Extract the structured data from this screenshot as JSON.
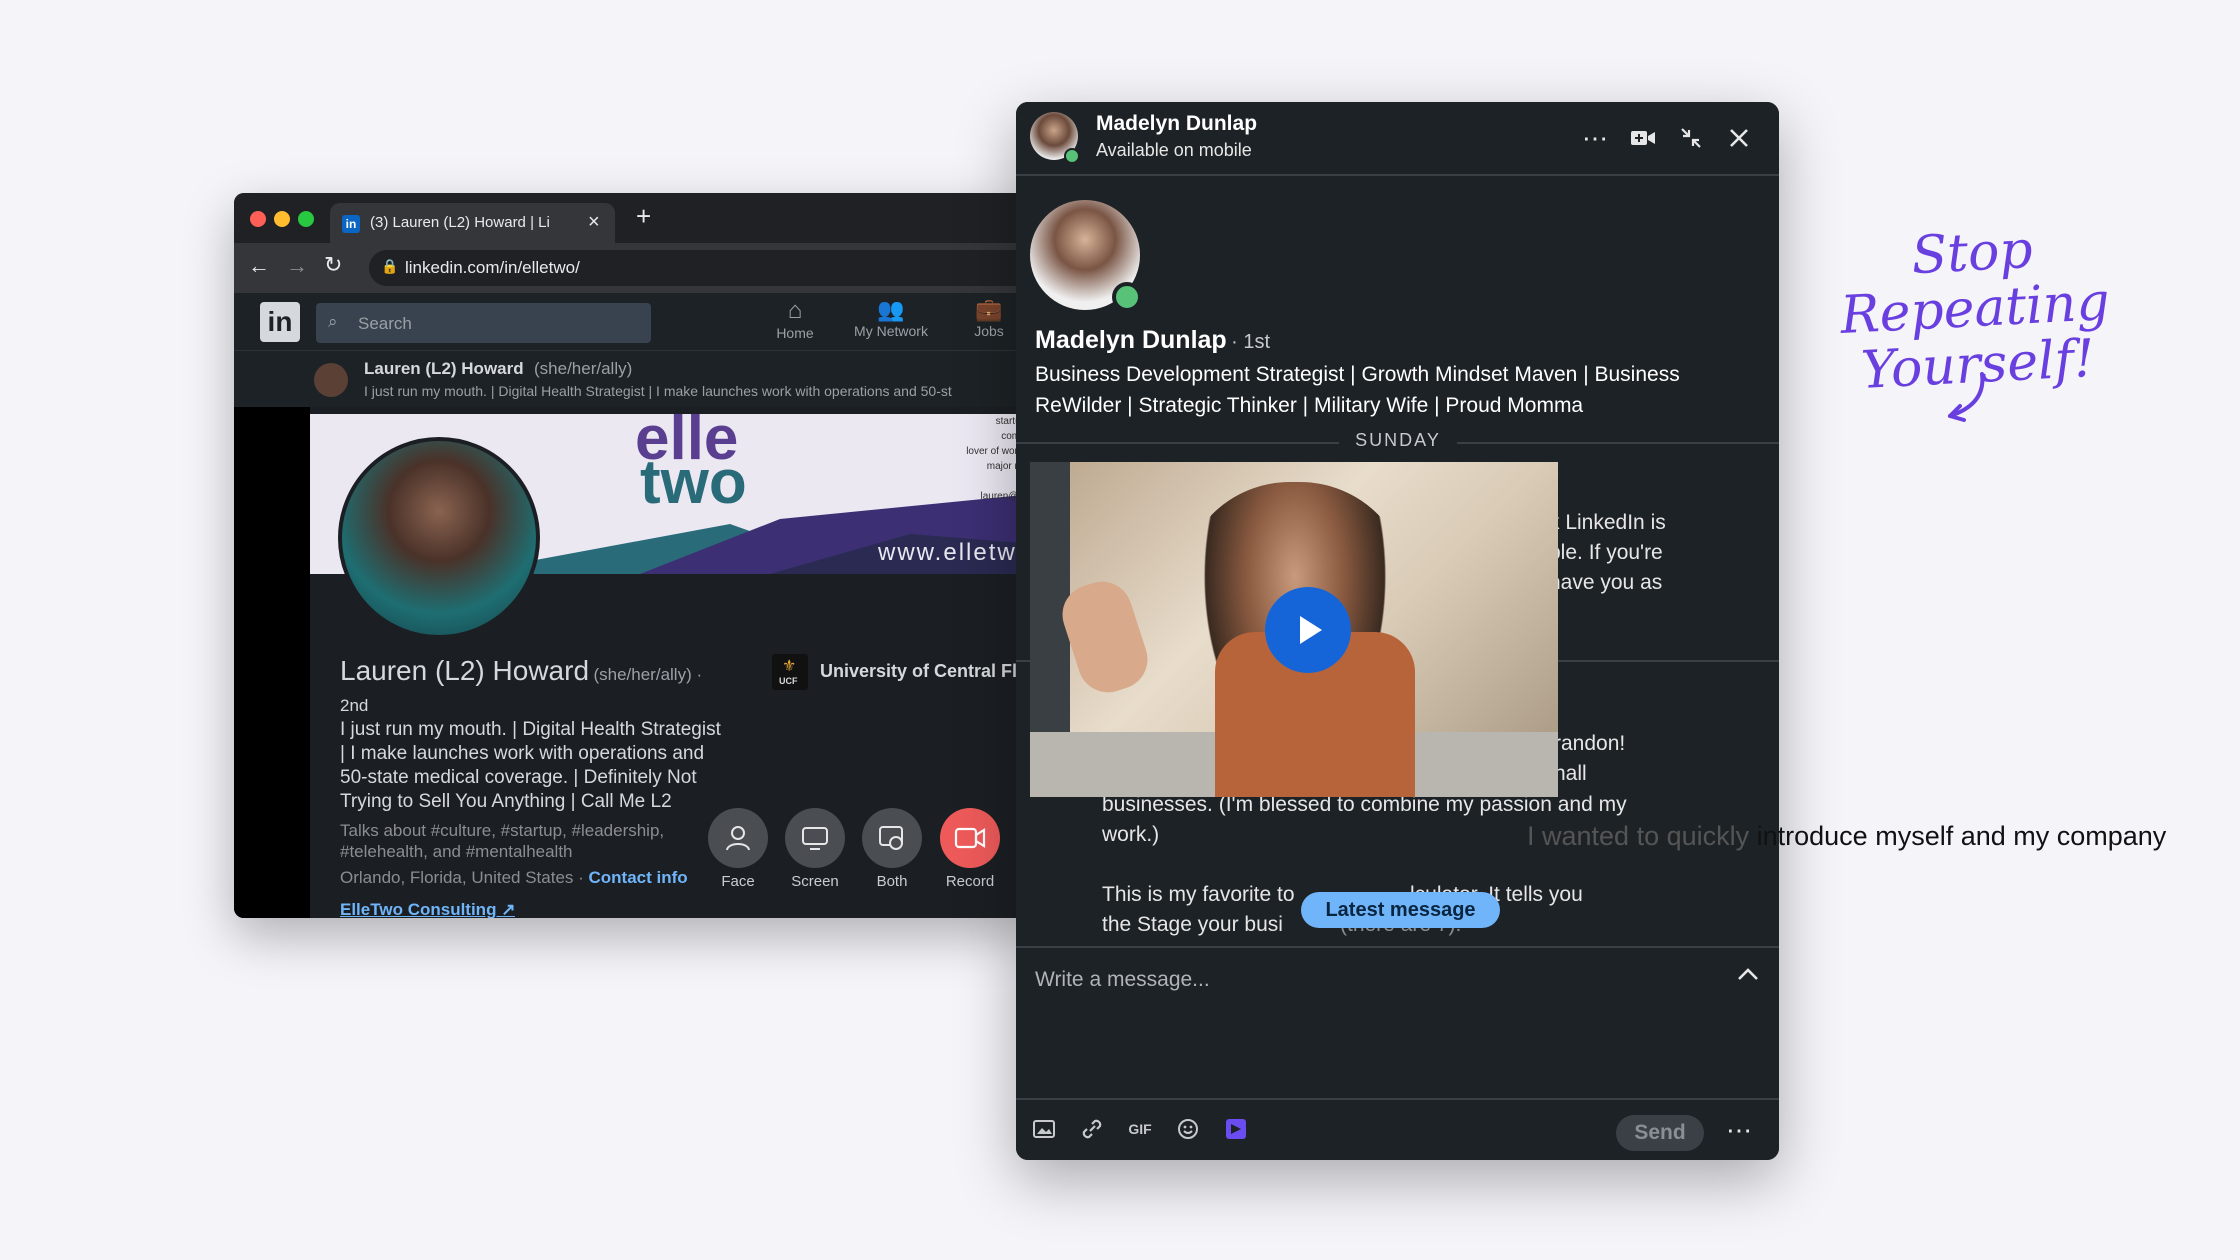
{
  "browser": {
    "tab_title": "(3) Lauren (L2) Howard | Li",
    "url": "linkedin.com/in/elletwo/",
    "search_placeholder": "Search",
    "nav": [
      {
        "label": "Home"
      },
      {
        "label": "My Network"
      },
      {
        "label": "Jobs"
      }
    ],
    "mini_profile": {
      "name": "Lauren (L2) Howard",
      "pronouns": "(she/her/ally)",
      "headline": "I just run my mouth. | Digital Health Strategist | I make launches work with operations and 50-st"
    }
  },
  "banner": {
    "brand_top": "elle",
    "brand_bottom": "two",
    "website": "www.elletwo",
    "side_lines": [
      "startup c",
      "commu",
      "lover of women",
      "major mou",
      "for",
      "lauren@elle"
    ]
  },
  "profile": {
    "name": "Lauren (L2) Howard",
    "pronouns": "(she/her/ally) ·",
    "degree": "2nd",
    "headline_lines": [
      "I just run my mouth. | Digital Health Strategist",
      "| I make launches work with operations and",
      "50-state medical coverage. | Definitely Not",
      "Trying to Sell You Anything | Call Me L2"
    ],
    "talks_about_lines": [
      "Talks about #culture, #startup, #leadership,",
      "#telehealth, and #mentalhealth"
    ],
    "location": "Orlando, Florida, United States ·",
    "contact_link": "Contact info",
    "website_link": "ElleTwo Consulting",
    "education": "University of Central Flo",
    "ucf_badge": "UCF"
  },
  "record_controls": [
    {
      "label": "Face",
      "icon": "person-icon"
    },
    {
      "label": "Screen",
      "icon": "screen-icon"
    },
    {
      "label": "Both",
      "icon": "both-icon"
    },
    {
      "label": "Record",
      "icon": "video-camera-icon"
    }
  ],
  "chat": {
    "contact_name": "Madelyn Dunlap",
    "status": "Available on mobile",
    "profile_name": "Madelyn Dunlap",
    "degree": "· 1st",
    "headline_lines": [
      "Business Development Strategist | Growth Mindset Maven | Business",
      "ReWilder | Strategic Thinker | Military Wife | Proud Momma"
    ],
    "day_divider": "SUNDAY",
    "msg1_lines": [
      "k LinkedIn is",
      "ple. If you're",
      "have you as"
    ],
    "msg2_lines": [
      "randon!",
      "nall"
    ],
    "msg3_lines": [
      "businesses. (I'm blessed to combine my passion and my",
      "work.)"
    ],
    "msg4_lines": [
      "This is my favorite to",
      "lculator. It tells you",
      "the Stage your busi",
      "(there are 7):"
    ],
    "latest_message": "Latest message",
    "compose_placeholder": "Write a message...",
    "send_label": "Send",
    "accent_color": "#70b5f9",
    "online_color": "#57c278"
  },
  "handwritten": {
    "line1": "Stop Repeating",
    "line2": "Yourself!"
  },
  "overlay_text": {
    "faded": "I wanted to quickly ",
    "main": "introduce myself and my company"
  }
}
